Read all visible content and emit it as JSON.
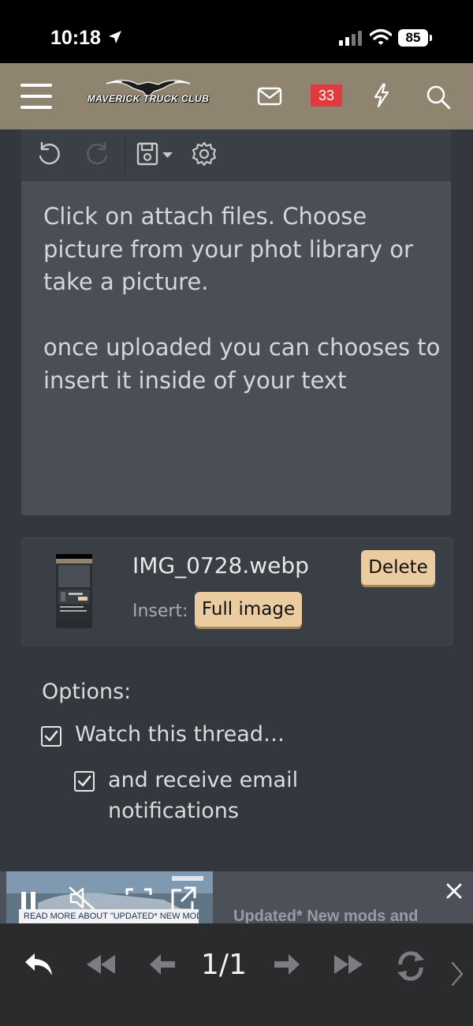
{
  "status_bar": {
    "time": "10:18",
    "battery": "85"
  },
  "header": {
    "logo_text": "MAVERICK TRUCK CLUB",
    "alerts_count": "33",
    "icons": [
      "menu-icon",
      "mail-icon",
      "bolt-icon",
      "search-icon"
    ]
  },
  "editor": {
    "toolbar_icons": [
      "undo-icon",
      "redo-icon",
      "save-draft-icon",
      "gear-icon"
    ],
    "paragraph1": "Click on attach files. Choose picture from your phot library or take a picture.",
    "paragraph2": "once uploaded you can chooses to insert it inside of your text"
  },
  "attachment": {
    "filename": "IMG_0728.webp",
    "insert_label": "Insert:",
    "full_image_button": "Full image",
    "delete_button": "Delete"
  },
  "options": {
    "title": "Options:",
    "watch_label": "Watch this thread…",
    "watch_checked": true,
    "email_label": "and receive email notifications",
    "email_checked": true
  },
  "ad": {
    "read_more": "READ MORE ABOUT \"UPDATED* NEW MODS AND MORE TO COME\"",
    "headline": "Updated* New mods and"
  },
  "bottom_bar": {
    "page_indicator": "1/1",
    "icons": [
      "reply-icon",
      "first-page-icon",
      "previous-page-icon",
      "next-page-icon",
      "last-page-icon",
      "refresh-icon",
      "chevron-right-icon"
    ]
  },
  "colors": {
    "header_bg": "#8e8470",
    "badge_red": "#e0393e",
    "button_tan": "#ebcba0",
    "editor_bg": "#4a4e57",
    "page_bg": "#33373e"
  }
}
